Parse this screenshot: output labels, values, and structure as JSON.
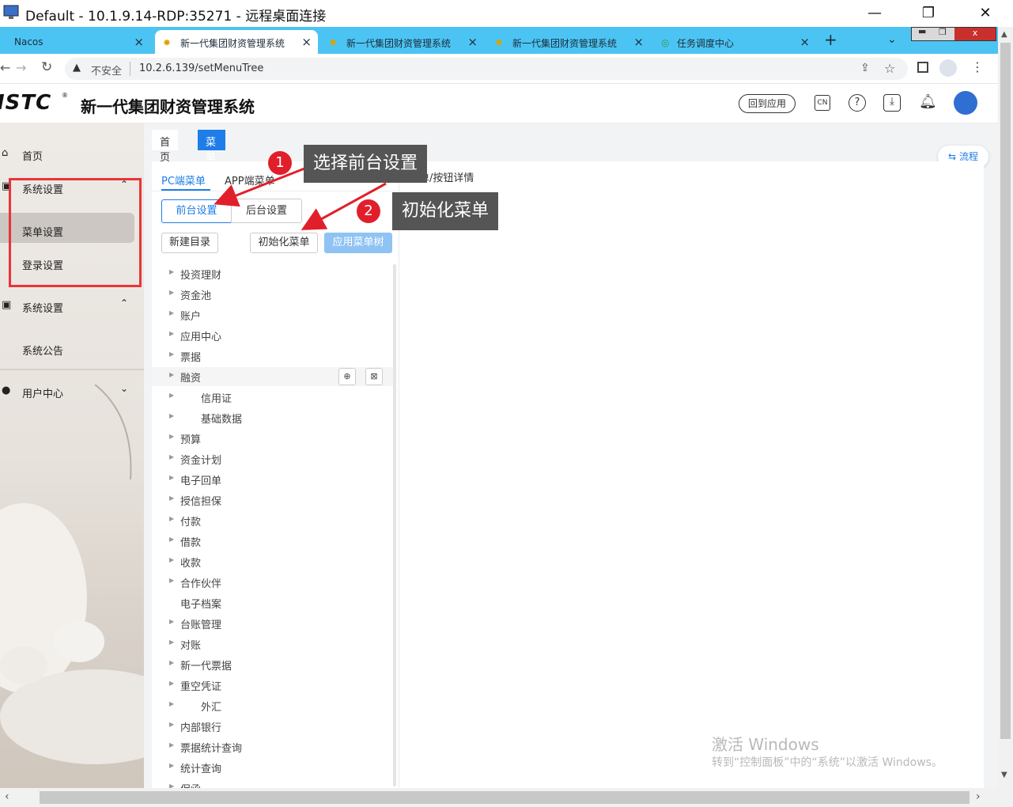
{
  "rdp": {
    "title": "Default - 10.1.9.14-RDP:35271 - 远程桌面连接"
  },
  "browser": {
    "tabs": [
      {
        "label": "Nacos"
      },
      {
        "label": "新一代集团财资管理系统"
      },
      {
        "label": "新一代集团财资管理系统"
      },
      {
        "label": "新一代集团财资管理系统"
      },
      {
        "label": "任务调度中心"
      }
    ],
    "security_label": "不安全",
    "url": "10.2.6.139/setMenuTree"
  },
  "header": {
    "logo": "ISTC",
    "title": "新一代集团财资管理系统",
    "back_label": "回到应用",
    "lang": "CN"
  },
  "sidebar": {
    "items": [
      {
        "label": "首页"
      },
      {
        "label": "系统设置"
      },
      {
        "label": "菜单设置"
      },
      {
        "label": "登录设置"
      },
      {
        "label": "系统设置"
      },
      {
        "label": "系统公告"
      },
      {
        "label": "用户中心"
      }
    ]
  },
  "pagetabs": {
    "home": "首页",
    "current": "菜单权限设置",
    "close": "×"
  },
  "panel": {
    "pc_tab": "PC端菜单",
    "app_tab": "APP端菜单",
    "front_btn": "前台设置",
    "back_btn": "后台设置",
    "new_dir_btn": "新建目录",
    "init_btn": "初始化菜单",
    "apply_btn": "应用菜单树",
    "detail_title": "菜单/按钮详情",
    "flow_btn": "流程"
  },
  "tree": [
    {
      "label": "投资理财"
    },
    {
      "label": "资金池"
    },
    {
      "label": "账户"
    },
    {
      "label": "应用中心"
    },
    {
      "label": "票据"
    },
    {
      "label": "融资"
    },
    {
      "label": "信用证"
    },
    {
      "label": "基础数据"
    },
    {
      "label": "预算"
    },
    {
      "label": "资金计划"
    },
    {
      "label": "电子回单"
    },
    {
      "label": "授信担保"
    },
    {
      "label": "付款"
    },
    {
      "label": "借款"
    },
    {
      "label": "收款"
    },
    {
      "label": "合作伙伴"
    },
    {
      "label": "电子档案"
    },
    {
      "label": "台账管理"
    },
    {
      "label": "对账"
    },
    {
      "label": "新一代票据"
    },
    {
      "label": "重空凭证"
    },
    {
      "label": "外汇"
    },
    {
      "label": "内部银行"
    },
    {
      "label": "票据统计查询"
    },
    {
      "label": "统计查询"
    },
    {
      "label": "保函"
    }
  ],
  "annotations": {
    "step1_num": "1",
    "step1_text": "选择前台设置",
    "step2_num": "2",
    "step2_text": "初始化菜单"
  },
  "watermark": {
    "line1": "激活 Windows",
    "line2": "转到“控制面板”中的“系统”以激活 Windows。"
  },
  "colors": {
    "accent": "#1e7de8",
    "tabbar": "#4cc4f3",
    "annotation_red": "#e11f2b"
  }
}
